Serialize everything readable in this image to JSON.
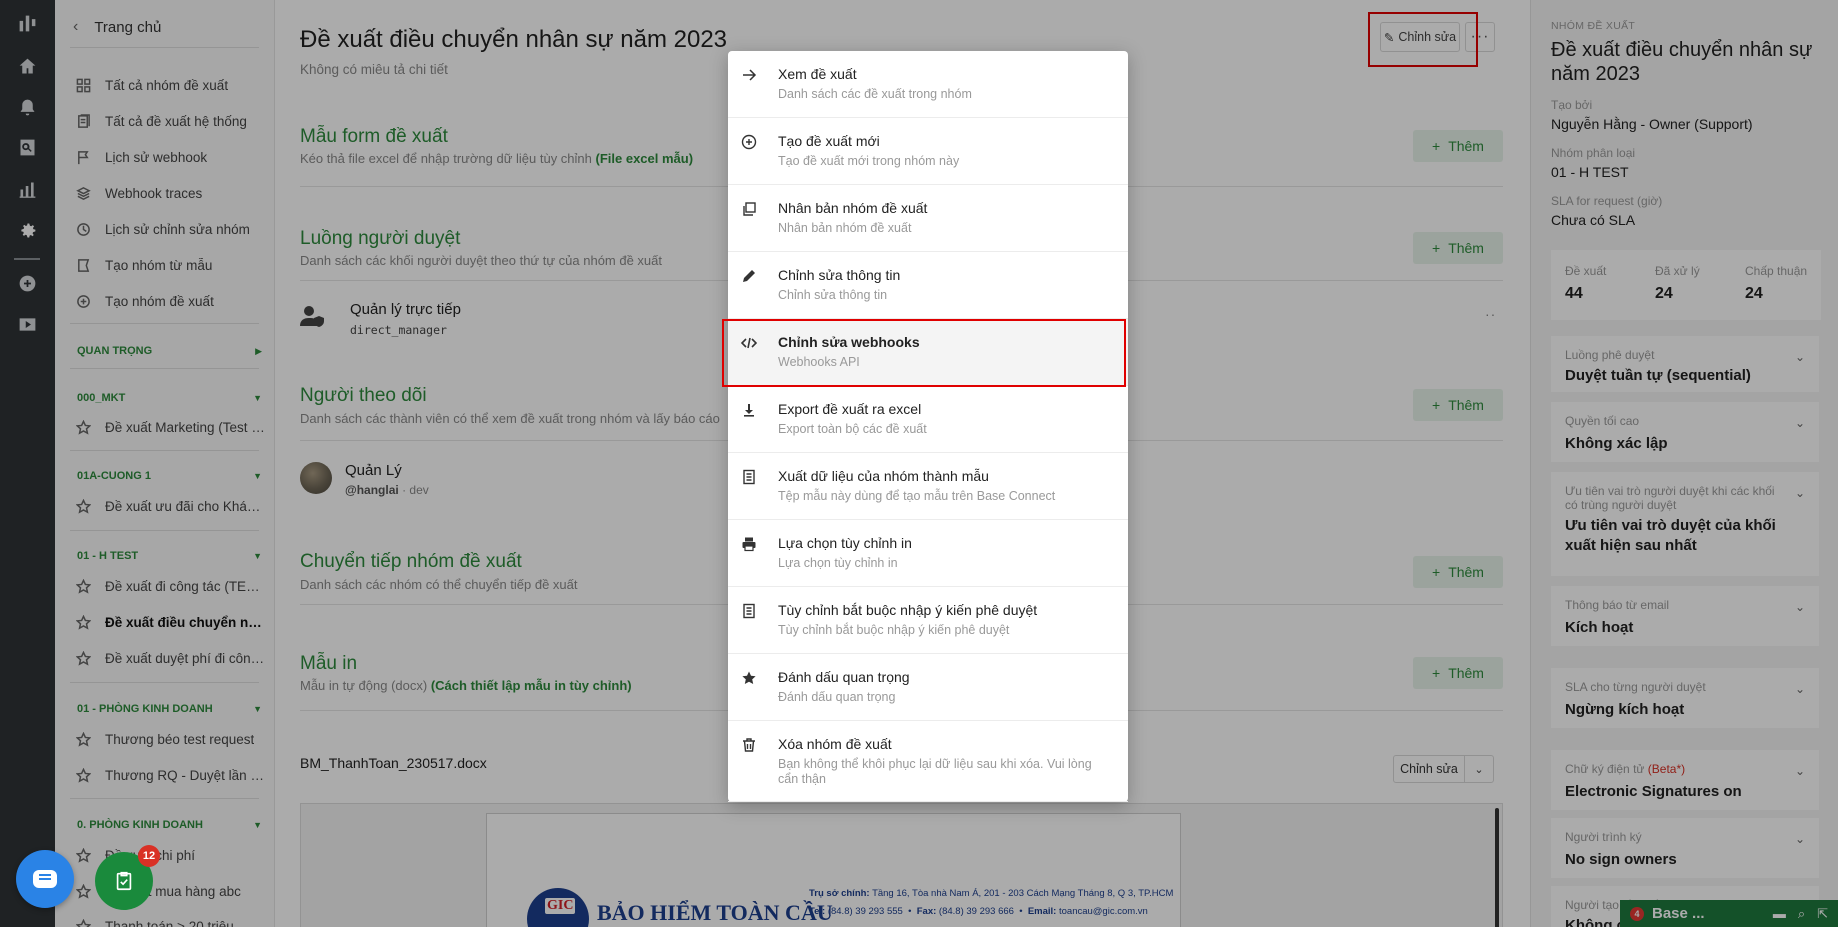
{
  "sidebar": {
    "back_label": "Trang chủ",
    "nav": [
      {
        "label": "Tất cả nhóm đề xuất",
        "icon": "grid-icon"
      },
      {
        "label": "Tất cả đề xuất hệ thống",
        "icon": "documents-icon"
      },
      {
        "label": "Lịch sử webhook",
        "icon": "flag-icon"
      },
      {
        "label": "Webhook traces",
        "icon": "layers-icon"
      },
      {
        "label": "Lịch sử chỉnh sửa nhóm",
        "icon": "clock-icon"
      },
      {
        "label": "Tạo nhóm từ mẫu",
        "icon": "template-icon"
      },
      {
        "label": "Tạo nhóm đề xuất",
        "icon": "plus-circle-icon"
      }
    ],
    "sections": [
      {
        "title": "QUAN TRỌNG",
        "items": []
      },
      {
        "title": "000_MKT",
        "items": [
          "Đề xuất Marketing (Test c..."
        ]
      },
      {
        "title": "01A-CUONG 1",
        "items": [
          "Đề xuất ưu đãi cho Khách..."
        ]
      },
      {
        "title": "01 - H TEST",
        "items": [
          "Đề xuất đi công tác (TEST)",
          "Đề xuất điều chuyển nhâ...",
          "Đề xuất duyệt phí đi công ..."
        ]
      },
      {
        "title": "01 - PHÒNG KINH DOANH",
        "items": [
          "Thương béo test request",
          "Thương RQ - Duyệt lần lượt"
        ]
      },
      {
        "title": "0. PHÒNG KINH DOANH",
        "items": [
          "Đề xuất chi phí",
          "Đề xuất mua hàng abc",
          "Thanh toán > 20 triệu"
        ]
      }
    ]
  },
  "main": {
    "title": "Đề xuất điều chuyển nhân sự năm 2023",
    "subtitle": "Không có miêu tả chi tiết",
    "edit_label": "Chỉnh sửa",
    "add_label": "Thêm",
    "sections": {
      "form": {
        "title": "Mẫu form đề xuất",
        "desc": "Kéo thả file excel để nhập trường dữ liệu tùy chỉnh",
        "link": "(File excel mẫu)"
      },
      "approvers": {
        "title": "Luồng người duyệt",
        "desc": "Danh sách các khối người duyệt theo thứ tự của nhóm đề xuất"
      },
      "followers": {
        "title": "Người theo dõi",
        "desc": "Danh sách các thành viên có thể xem đề xuất trong nhóm và lấy báo cáo"
      },
      "forward": {
        "title": "Chuyển tiếp nhóm đề xuất",
        "desc": "Danh sách các nhóm có thể chuyển tiếp đề xuất"
      },
      "print": {
        "title": "Mẫu in",
        "desc": "Mẫu in tự động (docx)",
        "link": "(Cách thiết lập mẫu in tùy chỉnh)"
      }
    },
    "approver": {
      "name": "Quản lý trực tiếp",
      "code": "direct_manager"
    },
    "follower": {
      "name": "Quản Lý",
      "username": "@hanglai",
      "dept": "· dev"
    },
    "file": {
      "name": "BM_ThanhToan_230517.docx",
      "edit_label": "Chỉnh sửa"
    },
    "preview": {
      "brand": "BẢO HIỂM TOÀN CẦU",
      "logo_text": "GIC",
      "address_label": "Trụ sở chính:",
      "address": "Tầng 16, Tòa nhà Nam Á, 201 - 203 Cách Mạng Tháng 8, Q 3, TP.HCM",
      "tel_label": "Tel:",
      "tel": "(84.8) 39 293 555",
      "fax_label": "Fax:",
      "fax": "(84.8) 39 293 666",
      "email_label": "Email:",
      "email": "toancau@gic.com.vn"
    }
  },
  "menu": {
    "items": [
      {
        "title": "Xem đề xuất",
        "desc": "Danh sách các đề xuất trong nhóm",
        "icon": "arrow-right-icon"
      },
      {
        "title": "Tạo đề xuất mới",
        "desc": "Tạo đề xuất mới trong nhóm này",
        "icon": "plus-circle-icon"
      },
      {
        "title": "Nhân bản nhóm đề xuất",
        "desc": "Nhân bản nhóm đề xuất",
        "icon": "copy-icon"
      },
      {
        "title": "Chỉnh sửa thông tin",
        "desc": "Chỉnh sửa thông tin",
        "icon": "pencil-icon"
      },
      {
        "title": "Chỉnh sửa webhooks",
        "desc": "Webhooks API",
        "icon": "code-icon"
      },
      {
        "title": "Export đề xuất ra excel",
        "desc": "Export toàn bộ các đề xuất",
        "icon": "download-icon"
      },
      {
        "title": "Xuất dữ liệu của nhóm thành mẫu",
        "desc": "Tệp mẫu này dùng để tạo mẫu trên Base Connect",
        "icon": "document-icon"
      },
      {
        "title": "Lựa chọn tùy chỉnh in",
        "desc": "Lựa chọn tùy chỉnh in",
        "icon": "printer-icon"
      },
      {
        "title": "Tùy chỉnh bắt buộc nhập ý kiến phê duyệt",
        "desc": "Tùy chỉnh bắt buộc nhập ý kiến phê duyệt",
        "icon": "document-icon"
      },
      {
        "title": "Đánh dấu quan trọng",
        "desc": "Đánh dấu quan trọng",
        "icon": "star-icon"
      },
      {
        "title": "Xóa nhóm đề xuất",
        "desc": "Bạn không thể khôi phục lại dữ liệu sau khi xóa. Vui lòng cẩn thận",
        "icon": "trash-icon"
      }
    ]
  },
  "right_panel": {
    "header_label": "NHÓM ĐỀ XUẤT",
    "title": "Đề xuất điều chuyển nhân sự năm 2023",
    "created_by_label": "Tạo bởi",
    "created_by": "Nguyễn Hằng - Owner (Support)",
    "category_label": "Nhóm phân loại",
    "category": "01 - H TEST",
    "sla_label": "SLA for request (giờ)",
    "sla": "Chưa có SLA",
    "stats": [
      {
        "label": "Đề xuất",
        "value": "44"
      },
      {
        "label": "Đã xử lý",
        "value": "24"
      },
      {
        "label": "Chấp thuận",
        "value": "24"
      }
    ],
    "cards": [
      {
        "label": "Luồng phê duyệt",
        "value": "Duyệt tuần tự (sequential)"
      },
      {
        "label": "Quyền tối cao",
        "value": "Không xác lập"
      },
      {
        "label": "Ưu tiên vai trò người duyệt khi các khối có trùng người duyệt",
        "value": "Ưu tiên vai trò duyệt của khối xuất hiện sau nhất"
      },
      {
        "label": "Thông báo từ email",
        "value": "Kích hoạt"
      },
      {
        "label": "SLA cho từng người duyệt",
        "value": "Ngừng kích hoạt"
      },
      {
        "label": "Chữ ký điện tử",
        "beta": "(Beta*)",
        "value": "Electronic Signatures on"
      },
      {
        "label": "Người trình ký",
        "value": "No sign owners"
      },
      {
        "label": "Người tạo đề xuất",
        "value": "Không chọn"
      }
    ]
  },
  "bottom_bar": {
    "badge": "4",
    "label": "Base ..."
  },
  "task_badge": "12"
}
